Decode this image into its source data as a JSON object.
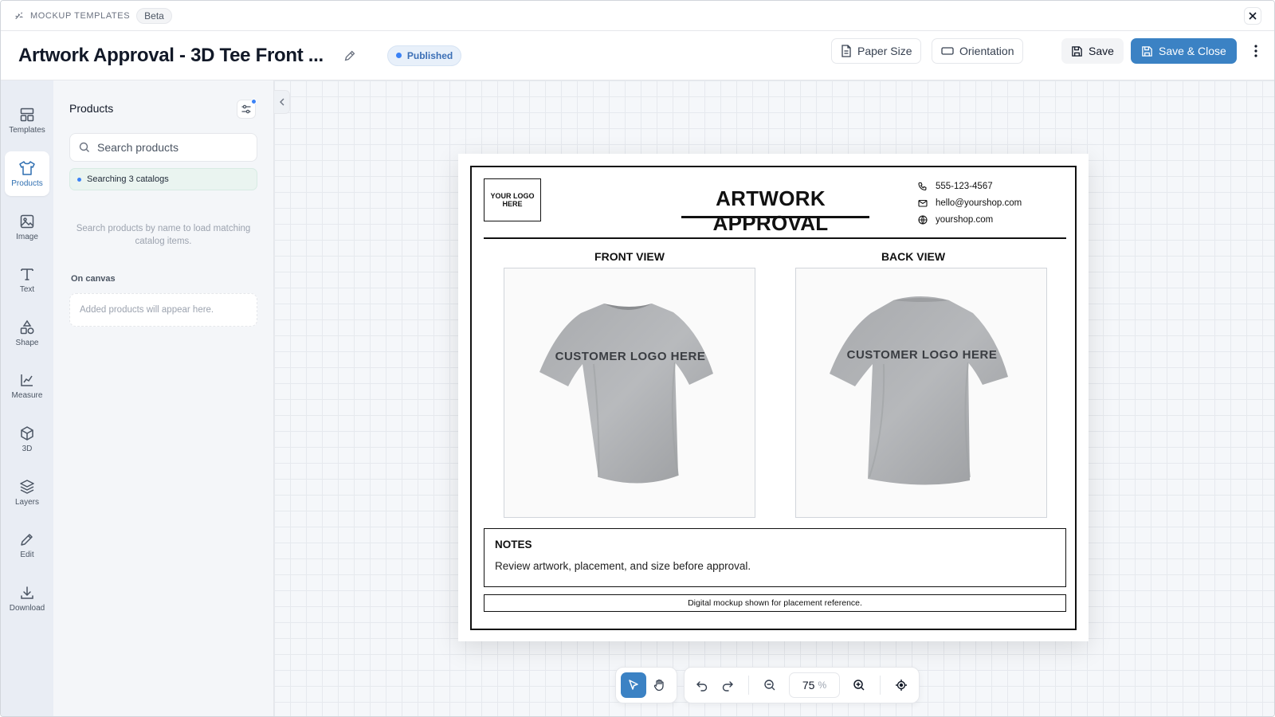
{
  "topbar": {
    "app_name": "MOCKUP TEMPLATES",
    "badge": "Beta"
  },
  "header": {
    "title": "Artwork Approval - 3D Tee Front ...",
    "status": "Published",
    "paper_size": "Paper Size",
    "orientation": "Orientation",
    "save": "Save",
    "save_close": "Save & Close"
  },
  "rail": {
    "items": [
      {
        "label": "Templates",
        "icon": "templates-icon"
      },
      {
        "label": "Products",
        "icon": "shirt-icon",
        "active": true
      },
      {
        "label": "Image",
        "icon": "image-icon"
      },
      {
        "label": "Text",
        "icon": "text-icon"
      },
      {
        "label": "Shape",
        "icon": "shapes-icon"
      },
      {
        "label": "Measure",
        "icon": "chart-icon"
      },
      {
        "label": "3D",
        "icon": "cube-icon"
      },
      {
        "label": "Layers",
        "icon": "layers-icon"
      },
      {
        "label": "Edit",
        "icon": "pencil-icon"
      },
      {
        "label": "Download",
        "icon": "download-icon"
      }
    ]
  },
  "panel": {
    "title": "Products",
    "search_placeholder": "Search products",
    "catalog_status": "Searching 3 catalogs",
    "hint": "Search products by name to load matching catalog items.",
    "on_canvas_label": "On canvas",
    "on_canvas_empty": "Added products will appear here."
  },
  "sheet": {
    "logo": "YOUR LOGO HERE",
    "title": "ARTWORK APPROVAL",
    "phone": "555-123-4567",
    "email": "hello@yourshop.com",
    "website": "yourshop.com",
    "front_label": "FRONT VIEW",
    "back_label": "BACK VIEW",
    "front_print": "CUSTOMER LOGO HERE",
    "back_print": "CUSTOMER LOGO HERE",
    "notes_title": "NOTES",
    "notes_text": "Review artwork, placement, and size before approval.",
    "footer": "Digital mockup shown for placement reference."
  },
  "toolbar": {
    "zoom": "75",
    "zoom_unit": "%"
  },
  "colors": {
    "accent": "#3b82c4",
    "status": "#3b6fb6",
    "rail_bg": "#e9edf4"
  }
}
